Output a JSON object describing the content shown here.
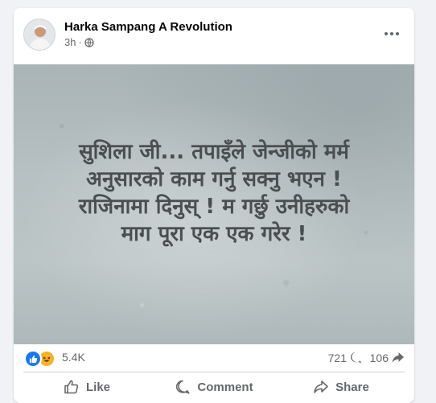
{
  "post": {
    "author": "Harka Sampang A Revolution",
    "time": "3h",
    "separator": "·",
    "privacy_icon": "globe-icon"
  },
  "image": {
    "lines": [
      "सुशिला जी... तपाइँले जेन्जीको मर्म",
      "अनुसारको काम गर्नु सक्नु भएन !",
      "राजिनामा दिनुस् ! म गर्छु उनीहरुको",
      "माग पूरा एक एक गरेर !"
    ]
  },
  "stats": {
    "reactions": "5.4K",
    "reaction_icons": [
      "like-icon",
      "haha-icon"
    ],
    "comments": "721",
    "shares": "106"
  },
  "actions": {
    "like": "Like",
    "comment": "Comment",
    "share": "Share"
  },
  "colors": {
    "brand_blue": "#1877f2",
    "haha_yellow": "#f7b125",
    "secondary_text": "#65676b"
  }
}
